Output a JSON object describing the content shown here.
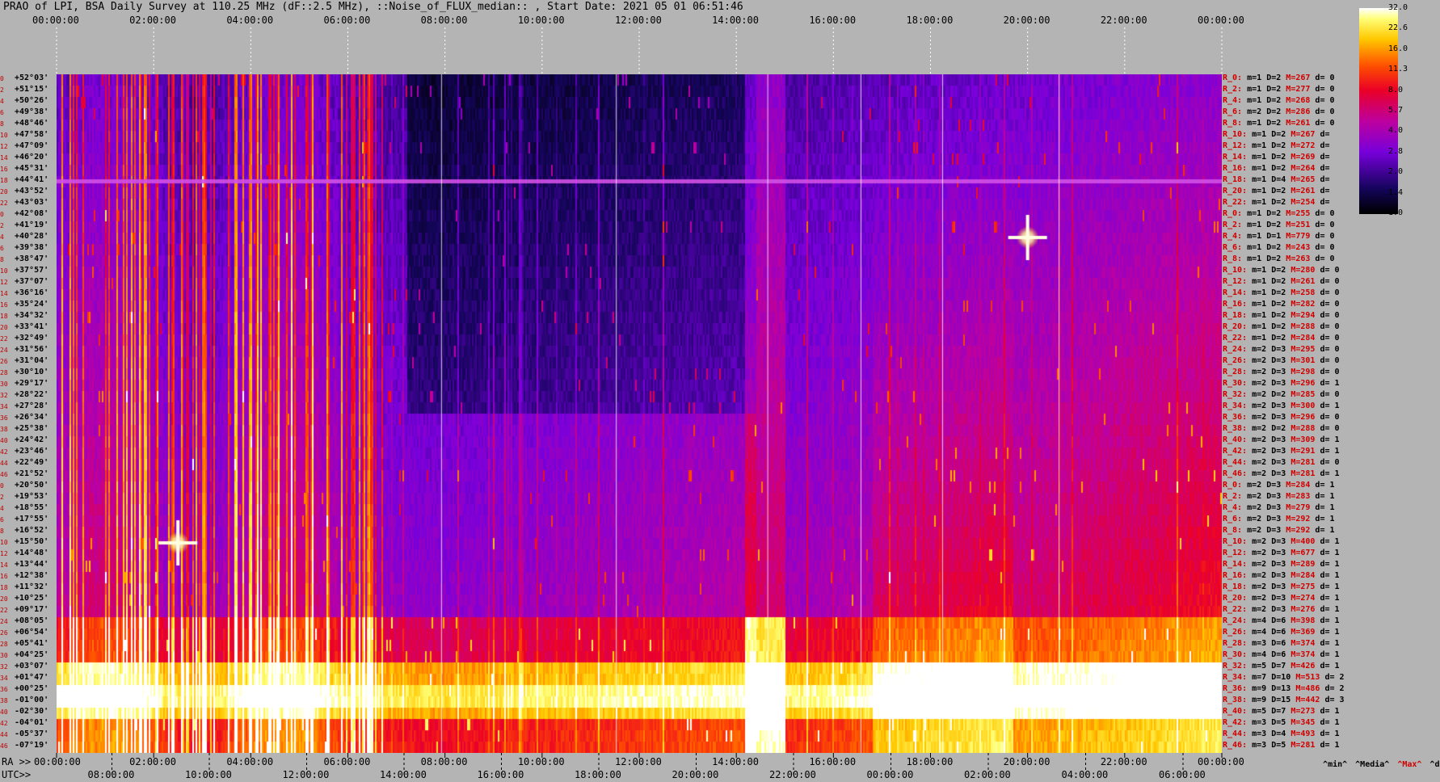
{
  "title": "PRAO of LPI, BSA Daily Survey at 110.25 MHz (dF::2.5 MHz), ::Noise_of_FLUX_median:: , Start Date: 2021 05 01 06:51:46",
  "ra_prefix": "RA >>",
  "utc_prefix": "UTC>>",
  "ra_ticks_top": [
    "00:00:00",
    "02:00:00",
    "04:00:00",
    "06:00:00",
    "08:00:00",
    "10:00:00",
    "12:00:00",
    "14:00:00",
    "16:00:00",
    "18:00:00",
    "20:00:00",
    "22:00:00",
    "00:00:00"
  ],
  "ra_ticks_bottom": [
    "00:00:00",
    "02:00:00",
    "04:00:00",
    "06:00:00",
    "08:00:00",
    "10:00:00",
    "12:00:00",
    "14:00:00",
    "16:00:00",
    "18:00:00",
    "20:00:00",
    "22:00:00",
    "00:00:00"
  ],
  "utc_ticks": [
    "08:00:00",
    "10:00:00",
    "12:00:00",
    "14:00:00",
    "16:00:00",
    "18:00:00",
    "20:00:00",
    "22:00:00",
    "00:00:00",
    "02:00:00",
    "04:00:00",
    "06:00:00"
  ],
  "legend": {
    "min": "^min^",
    "media": "^Media^",
    "max": "^Max^",
    "devia": "^devia^"
  },
  "colorbar_ticks": [
    "32.0",
    "22.6",
    "16.0",
    "11.3",
    "8.0",
    "5.7",
    "4.0",
    "2.8",
    "2.0",
    "1.4",
    "1.0"
  ],
  "colors": {
    "background": "#b4b4b4",
    "row_index": "#c00000",
    "max_text": "#d00000"
  },
  "chart_data": {
    "type": "heatmap",
    "title": "PRAO of LPI, BSA Daily Survey at 110.25 MHz (dF::2.5 MHz), ::Noise_of_FLUX_median:: , Start Date: 2021 05 01 06:51:46",
    "x_axis_top": "RA 00:00:00 - 24:00:00",
    "x_axis_bottom": "UTC 06:51:46 start",
    "colorscale_range": [
      1.0,
      32.0
    ],
    "colorscale": "log, black-blue-purple-red-yellow-white",
    "rows": [
      {
        "idx": "0",
        "dec": "+52°03'",
        "stat": [
          "R_0:",
          "m=1",
          "D=2",
          "M=267",
          "d= 0"
        ]
      },
      {
        "idx": "2",
        "dec": "+51°15'",
        "stat": [
          "R_2:",
          "m=1",
          "D=2",
          "M=277",
          "d= 0"
        ]
      },
      {
        "idx": "4",
        "dec": "+50°26'",
        "stat": [
          "R_4:",
          "m=1",
          "D=2",
          "M=268",
          "d= 0"
        ]
      },
      {
        "idx": "6",
        "dec": "+49°38'",
        "stat": [
          "R_6:",
          "m=2",
          "D=2",
          "M=286",
          "d= 0"
        ]
      },
      {
        "idx": "8",
        "dec": "+48°46'",
        "stat": [
          "R_8:",
          "m=1",
          "D=2",
          "M=261",
          "d= 0"
        ]
      },
      {
        "idx": "10",
        "dec": "+47°58'",
        "stat": [
          "R_10:",
          "m=1",
          "D=2",
          "M=267",
          "d="
        ]
      },
      {
        "idx": "12",
        "dec": "+47°09'",
        "stat": [
          "R_12:",
          "m=1",
          "D=2",
          "M=272",
          "d="
        ]
      },
      {
        "idx": "14",
        "dec": "+46°20'",
        "stat": [
          "R_14:",
          "m=1",
          "D=2",
          "M=269",
          "d="
        ]
      },
      {
        "idx": "16",
        "dec": "+45°31'",
        "stat": [
          "R_16:",
          "m=1",
          "D=2",
          "M=264",
          "d="
        ]
      },
      {
        "idx": "18",
        "dec": "+44°41'",
        "stat": [
          "R_18:",
          "m=1",
          "D=4",
          "M=265",
          "d="
        ]
      },
      {
        "idx": "20",
        "dec": "+43°52'",
        "stat": [
          "R_20:",
          "m=1",
          "D=2",
          "M=261",
          "d="
        ]
      },
      {
        "idx": "22",
        "dec": "+43°03'",
        "stat": [
          "R_22:",
          "m=1",
          "D=2",
          "M=254",
          "d="
        ]
      },
      {
        "idx": "0",
        "dec": "+42°08'",
        "stat": [
          "R_0:",
          "m=1",
          "D=2",
          "M=255",
          "d= 0"
        ]
      },
      {
        "idx": "2",
        "dec": "+41°19'",
        "stat": [
          "R_2:",
          "m=1",
          "D=2",
          "M=251",
          "d= 0"
        ]
      },
      {
        "idx": "4",
        "dec": "+40°28'",
        "stat": [
          "R_4:",
          "m=1",
          "D=1",
          "M=779",
          "d= 0"
        ]
      },
      {
        "idx": "6",
        "dec": "+39°38'",
        "stat": [
          "R_6:",
          "m=1",
          "D=2",
          "M=243",
          "d= 0"
        ]
      },
      {
        "idx": "8",
        "dec": "+38°47'",
        "stat": [
          "R_8:",
          "m=1",
          "D=2",
          "M=263",
          "d= 0"
        ]
      },
      {
        "idx": "10",
        "dec": "+37°57'",
        "stat": [
          "R_10:",
          "m=1",
          "D=2",
          "M=280",
          "d= 0"
        ]
      },
      {
        "idx": "12",
        "dec": "+37°07'",
        "stat": [
          "R_12:",
          "m=1",
          "D=2",
          "M=261",
          "d= 0"
        ]
      },
      {
        "idx": "14",
        "dec": "+36°16'",
        "stat": [
          "R_14:",
          "m=1",
          "D=2",
          "M=258",
          "d= 0"
        ]
      },
      {
        "idx": "16",
        "dec": "+35°24'",
        "stat": [
          "R_16:",
          "m=1",
          "D=2",
          "M=282",
          "d= 0"
        ]
      },
      {
        "idx": "18",
        "dec": "+34°32'",
        "stat": [
          "R_18:",
          "m=1",
          "D=2",
          "M=294",
          "d= 0"
        ]
      },
      {
        "idx": "20",
        "dec": "+33°41'",
        "stat": [
          "R_20:",
          "m=1",
          "D=2",
          "M=288",
          "d= 0"
        ]
      },
      {
        "idx": "22",
        "dec": "+32°49'",
        "stat": [
          "R_22:",
          "m=1",
          "D=2",
          "M=284",
          "d= 0"
        ]
      },
      {
        "idx": "24",
        "dec": "+31°56'",
        "stat": [
          "R_24:",
          "m=2",
          "D=3",
          "M=295",
          "d= 0"
        ]
      },
      {
        "idx": "26",
        "dec": "+31°04'",
        "stat": [
          "R_26:",
          "m=2",
          "D=3",
          "M=301",
          "d= 0"
        ]
      },
      {
        "idx": "28",
        "dec": "+30°10'",
        "stat": [
          "R_28:",
          "m=2",
          "D=3",
          "M=298",
          "d= 0"
        ]
      },
      {
        "idx": "30",
        "dec": "+29°17'",
        "stat": [
          "R_30:",
          "m=2",
          "D=3",
          "M=296",
          "d= 1"
        ]
      },
      {
        "idx": "32",
        "dec": "+28°22'",
        "stat": [
          "R_32:",
          "m=2",
          "D=2",
          "M=285",
          "d= 0"
        ]
      },
      {
        "idx": "34",
        "dec": "+27°28'",
        "stat": [
          "R_34:",
          "m=2",
          "D=3",
          "M=300",
          "d= 1"
        ]
      },
      {
        "idx": "36",
        "dec": "+26°34'",
        "stat": [
          "R_36:",
          "m=2",
          "D=3",
          "M=296",
          "d= 0"
        ]
      },
      {
        "idx": "38",
        "dec": "+25°38'",
        "stat": [
          "R_38:",
          "m=2",
          "D=2",
          "M=288",
          "d= 0"
        ]
      },
      {
        "idx": "40",
        "dec": "+24°42'",
        "stat": [
          "R_40:",
          "m=2",
          "D=3",
          "M=309",
          "d= 1"
        ]
      },
      {
        "idx": "42",
        "dec": "+23°46'",
        "stat": [
          "R_42:",
          "m=2",
          "D=3",
          "M=291",
          "d= 1"
        ]
      },
      {
        "idx": "44",
        "dec": "+22°49'",
        "stat": [
          "R_44:",
          "m=2",
          "D=3",
          "M=281",
          "d= 0"
        ]
      },
      {
        "idx": "46",
        "dec": "+21°52'",
        "stat": [
          "R_46:",
          "m=2",
          "D=3",
          "M=281",
          "d= 1"
        ]
      },
      {
        "idx": "0",
        "dec": "+20°50'",
        "stat": [
          "R_0:",
          "m=2",
          "D=3",
          "M=284",
          "d= 1"
        ]
      },
      {
        "idx": "2",
        "dec": "+19°53'",
        "stat": [
          "R_2:",
          "m=2",
          "D=3",
          "M=283",
          "d= 1"
        ]
      },
      {
        "idx": "4",
        "dec": "+18°55'",
        "stat": [
          "R_4:",
          "m=2",
          "D=3",
          "M=279",
          "d= 1"
        ]
      },
      {
        "idx": "6",
        "dec": "+17°55'",
        "stat": [
          "R_6:",
          "m=2",
          "D=3",
          "M=292",
          "d= 1"
        ]
      },
      {
        "idx": "8",
        "dec": "+16°52'",
        "stat": [
          "R_8:",
          "m=2",
          "D=3",
          "M=292",
          "d= 1"
        ]
      },
      {
        "idx": "10",
        "dec": "+15°50'",
        "stat": [
          "R_10:",
          "m=2",
          "D=3",
          "M=400",
          "d= 1"
        ]
      },
      {
        "idx": "12",
        "dec": "+14°48'",
        "stat": [
          "R_12:",
          "m=2",
          "D=3",
          "M=677",
          "d= 1"
        ]
      },
      {
        "idx": "14",
        "dec": "+13°44'",
        "stat": [
          "R_14:",
          "m=2",
          "D=3",
          "M=289",
          "d= 1"
        ]
      },
      {
        "idx": "16",
        "dec": "+12°38'",
        "stat": [
          "R_16:",
          "m=2",
          "D=3",
          "M=284",
          "d= 1"
        ]
      },
      {
        "idx": "18",
        "dec": "+11°32'",
        "stat": [
          "R_18:",
          "m=2",
          "D=3",
          "M=275",
          "d= 1"
        ]
      },
      {
        "idx": "20",
        "dec": "+10°25'",
        "stat": [
          "R_20:",
          "m=2",
          "D=3",
          "M=274",
          "d= 1"
        ]
      },
      {
        "idx": "22",
        "dec": "+09°17'",
        "stat": [
          "R_22:",
          "m=2",
          "D=3",
          "M=276",
          "d= 1"
        ]
      },
      {
        "idx": "24",
        "dec": "+08°05'",
        "stat": [
          "R_24:",
          "m=4",
          "D=6",
          "M=398",
          "d= 1"
        ]
      },
      {
        "idx": "26",
        "dec": "+06°54'",
        "stat": [
          "R_26:",
          "m=4",
          "D=6",
          "M=369",
          "d= 1"
        ]
      },
      {
        "idx": "28",
        "dec": "+05°41'",
        "stat": [
          "R_28:",
          "m=3",
          "D=6",
          "M=374",
          "d= 1"
        ]
      },
      {
        "idx": "30",
        "dec": "+04°25'",
        "stat": [
          "R_30:",
          "m=4",
          "D=6",
          "M=374",
          "d= 1"
        ]
      },
      {
        "idx": "32",
        "dec": "+03°07'",
        "stat": [
          "R_32:",
          "m=5",
          "D=7",
          "M=426",
          "d= 1"
        ]
      },
      {
        "idx": "34",
        "dec": "+01°47'",
        "stat": [
          "R_34:",
          "m=7",
          "D=10",
          "M=513",
          "d= 2"
        ]
      },
      {
        "idx": "36",
        "dec": "+00°25'",
        "stat": [
          "R_36:",
          "m=9",
          "D=13",
          "M=486",
          "d= 2"
        ]
      },
      {
        "idx": "38",
        "dec": "-01°00'",
        "stat": [
          "R_38:",
          "m=9",
          "D=15",
          "M=442",
          "d= 3"
        ]
      },
      {
        "idx": "40",
        "dec": "-02°30'",
        "stat": [
          "R_40:",
          "m=5",
          "D=7",
          "M=273",
          "d= 1"
        ]
      },
      {
        "idx": "42",
        "dec": "-04°01'",
        "stat": [
          "R_42:",
          "m=3",
          "D=5",
          "M=345",
          "d= 1"
        ]
      },
      {
        "idx": "44",
        "dec": "-05°37'",
        "stat": [
          "R_44:",
          "m=3",
          "D=4",
          "M=493",
          "d= 1"
        ]
      },
      {
        "idx": "46",
        "dec": "-07°19'",
        "stat": [
          "R_46:",
          "m=3",
          "D=5",
          "M=281",
          "d= 1"
        ]
      }
    ],
    "sources": [
      {
        "ra": "20:00:00",
        "dec": "+40°28'",
        "note": "bright point source"
      },
      {
        "ra": "02:30:00",
        "dec": "+15°50'",
        "note": "bright point source"
      }
    ]
  }
}
